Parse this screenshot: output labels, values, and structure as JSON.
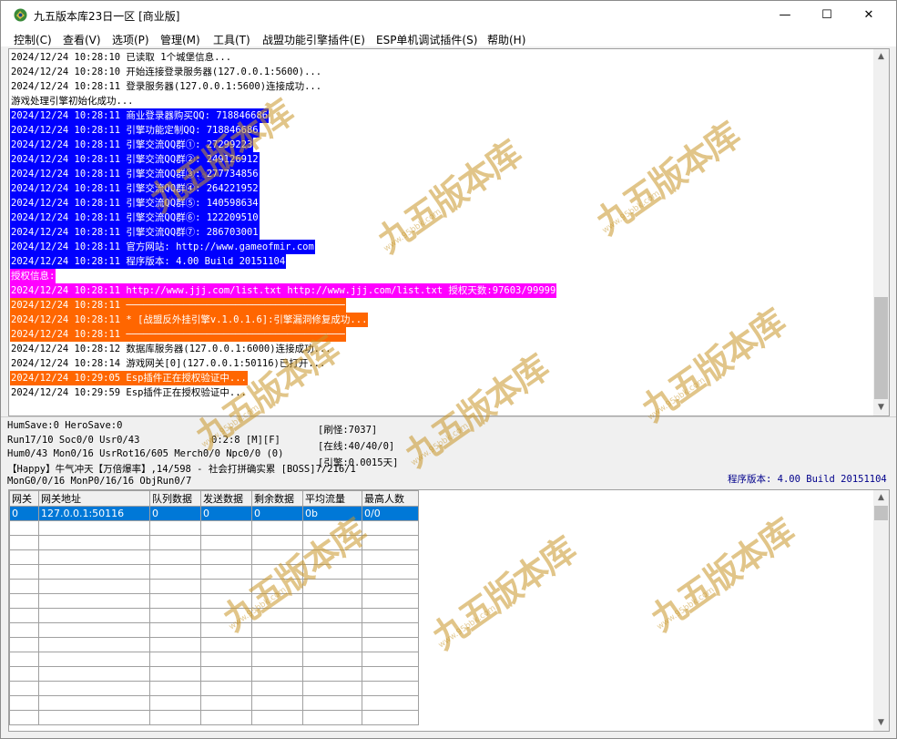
{
  "window": {
    "title": "九五版本库23日一区 [商业版]",
    "minimize": "—",
    "maximize": "☐",
    "close": "✕"
  },
  "menu": [
    "控制(C)",
    "查看(V)",
    "选项(P)",
    "管理(M)",
    "工具(T)",
    "战盟功能引擎插件(E)",
    "ESP单机调试插件(S)",
    "帮助(H)"
  ],
  "log": {
    "lines": [
      {
        "text": "2024/12/24 10:28:10 已读取 1个城堡信息...",
        "style": "normal"
      },
      {
        "text": "2024/12/24 10:28:10 开始连接登录服务器(127.0.0.1:5600)...",
        "style": "normal"
      },
      {
        "text": "2024/12/24 10:28:11 登录服务器(127.0.0.1:5600)连接成功...",
        "style": "normal"
      },
      {
        "text": "游戏处理引擎初始化成功...",
        "style": "normal"
      },
      {
        "text": "2024/12/24 10:28:11 商业登录器购买QQ: 718846686",
        "style": "blue"
      },
      {
        "text": "2024/12/24 10:28:11 引擎功能定制QQ: 718846686",
        "style": "blue"
      },
      {
        "text": "2024/12/24 10:28:11 引擎交流QQ群①: 27299223",
        "style": "blue"
      },
      {
        "text": "2024/12/24 10:28:11 引擎交流QQ群②: 249126912",
        "style": "blue"
      },
      {
        "text": "2024/12/24 10:28:11 引擎交流QQ群③: 277734856",
        "style": "blue"
      },
      {
        "text": "2024/12/24 10:28:11 引擎交流QQ群④: 264221952",
        "style": "blue"
      },
      {
        "text": "2024/12/24 10:28:11 引擎交流QQ群⑤: 140598634",
        "style": "blue"
      },
      {
        "text": "2024/12/24 10:28:11 引擎交流QQ群⑥: 122209510",
        "style": "blue"
      },
      {
        "text": "2024/12/24 10:28:11 引擎交流QQ群⑦: 286703001",
        "style": "blue"
      },
      {
        "text": "2024/12/24 10:28:11 官方网站: http://www.gameofmir.com",
        "style": "blue"
      },
      {
        "text": "2024/12/24 10:28:11 程序版本: 4.00 Build 20151104",
        "style": "blue"
      },
      {
        "text": "授权信息:",
        "style": "magenta"
      },
      {
        "text": "2024/12/24 10:28:11 http://www.jjj.com/list.txt http://www.jjj.com/list.txt 授权天数:97603/99999",
        "style": "magenta"
      },
      {
        "text": "2024/12/24 10:28:11 ──────────────────────────────────────",
        "style": "orange"
      },
      {
        "text": "2024/12/24 10:28:11 * [战盟反外挂引擎v.1.0.1.6]:引擎漏洞修复成功...",
        "style": "orange"
      },
      {
        "text": "2024/12/24 10:28:11 ──────────────────────────────────────",
        "style": "orange"
      },
      {
        "text": "2024/12/24 10:28:12 数据库服务器(127.0.0.1:6000)连接成功...",
        "style": "normal"
      },
      {
        "text": "2024/12/24 10:28:14 游戏网关[0](127.0.0.1:50116)已打开...",
        "style": "normal"
      },
      {
        "text": "2024/12/24 10:29:05 Esp插件正在授权验证中...",
        "style": "orange"
      },
      {
        "text": "2024/12/24 10:29:59 Esp插件正在授权验证中...",
        "style": "normal"
      }
    ]
  },
  "status": {
    "line1": "HumSave:0 HeroSave:0",
    "line2": "Run17/10 Soc0/0 Usr0/43",
    "line2b": "0:2:8 [M][F]",
    "line3": "Hum0/43 Mon0/16 UsrRot16/605 Merch0/0 Npc0/0 (0)",
    "line4": "【Happy】牛气冲天【万倍爆率】,14/598 - 社会打拼确实累 [BOSS]7/216/1",
    "line5": "MonG0/0/16 MonP0/16/16 ObjRun0/7",
    "right1": "[刷怪:7037]",
    "right2": "[在线:40/40/0]",
    "right3": "[引擎:0.0015天]",
    "version": "程序版本: 4.00 Build 20151104"
  },
  "gateways": {
    "headers": [
      "网关",
      "网关地址",
      "队列数据",
      "发送数据",
      "剩余数据",
      "平均流量",
      "最高人数"
    ],
    "rows": [
      [
        "0",
        "127.0.0.1:50116",
        "0",
        "0",
        "0",
        "0b",
        "0/0"
      ]
    ],
    "empty_rows": 14
  },
  "watermark": {
    "text": "九五版本库",
    "url": "www.95bbk.com"
  },
  "colors": {
    "highlight_blue": "#0000ff",
    "highlight_magenta": "#ff00ff",
    "highlight_orange": "#ff6600",
    "selection": "#0078d7"
  }
}
